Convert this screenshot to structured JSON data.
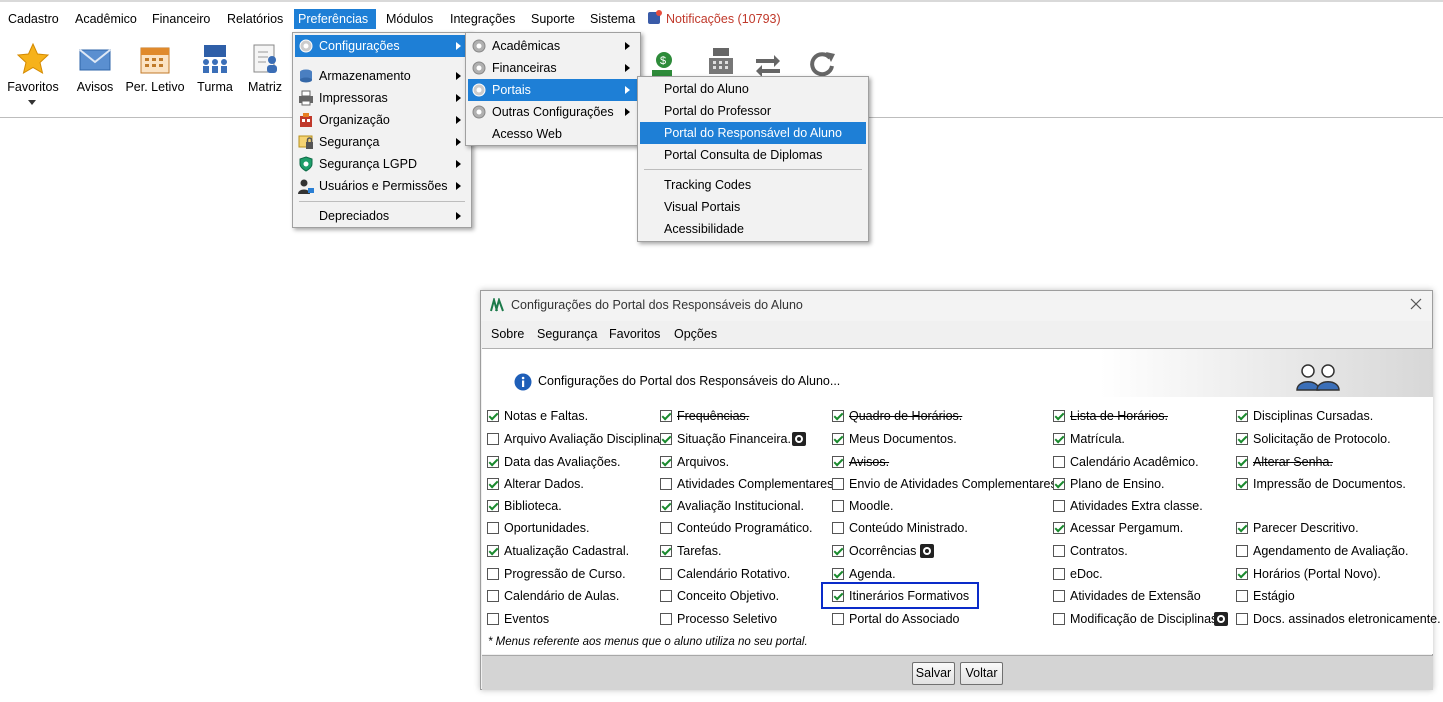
{
  "menubar": {
    "items": [
      "Cadastro",
      "Acadêmico",
      "Financeiro",
      "Relatórios",
      "Preferências",
      "Módulos",
      "Integrações",
      "Suporte",
      "Sistema"
    ],
    "notifications": "Notificações (10793)"
  },
  "toolbar": {
    "favoritos": "Favoritos",
    "avisos": "Avisos",
    "per_letivo": "Per. Letivo",
    "turma": "Turma",
    "matriz": "Matriz"
  },
  "menu_preferencias": {
    "items": [
      "Configurações",
      "Armazenamento",
      "Impressoras",
      "Organização",
      "Segurança",
      "Segurança LGPD",
      "Usuários e Permissões",
      "Depreciados"
    ]
  },
  "menu_configuracoes": {
    "items": [
      "Acadêmicas",
      "Financeiras",
      "Portais",
      "Outras Configurações",
      "Acesso Web"
    ]
  },
  "menu_portais": {
    "items": [
      "Portal do Aluno",
      "Portal do Professor",
      "Portal do Responsável do Aluno",
      "Portal Consulta de Diplomas",
      "Tracking Codes",
      "Visual Portais",
      "Acessibilidade"
    ]
  },
  "dialog": {
    "title": "Configurações do Portal dos Responsáveis do Aluno",
    "menu": [
      "Sobre",
      "Segurança",
      "Favoritos",
      "Opções"
    ],
    "header": "Configurações do Portal dos Responsáveis do Aluno...",
    "footnote": "* Menus referente aos menus que o aluno utiliza no seu portal.",
    "save": "Salvar",
    "back": "Voltar",
    "columns": [
      [
        {
          "label": "Notas e Faltas.",
          "checked": true
        },
        {
          "label": "Arquivo Avaliação Disciplina.",
          "checked": false
        },
        {
          "label": "Data das Avaliações.",
          "checked": true
        },
        {
          "label": "Alterar Dados.",
          "checked": true
        },
        {
          "label": "Biblioteca.",
          "checked": true
        },
        {
          "label": "Oportunidades.",
          "checked": false
        },
        {
          "label": "Atualização Cadastral.",
          "checked": true
        },
        {
          "label": "Progressão de Curso.",
          "checked": false
        },
        {
          "label": "Calendário de Aulas.",
          "checked": false
        },
        {
          "label": "Eventos",
          "checked": false
        }
      ],
      [
        {
          "label": "Frequências.",
          "checked": true,
          "strike": true
        },
        {
          "label": "Situação Financeira.",
          "checked": true,
          "gear": true
        },
        {
          "label": "Arquivos.",
          "checked": true
        },
        {
          "label": "Atividades Complementares.",
          "checked": false
        },
        {
          "label": "Avaliação Institucional.",
          "checked": true
        },
        {
          "label": "Conteúdo Programático.",
          "checked": false
        },
        {
          "label": "Tarefas.",
          "checked": true
        },
        {
          "label": "Calendário Rotativo.",
          "checked": false
        },
        {
          "label": "Conceito Objetivo.",
          "checked": false
        },
        {
          "label": "Processo Seletivo",
          "checked": false
        }
      ],
      [
        {
          "label": "Quadro de Horários.",
          "checked": true,
          "strike": true
        },
        {
          "label": "Meus Documentos.",
          "checked": true
        },
        {
          "label": "Avisos.",
          "checked": true,
          "strike": true
        },
        {
          "label": "Envio de Atividades Complementares.",
          "checked": false
        },
        {
          "label": "Moodle.",
          "checked": false
        },
        {
          "label": "Conteúdo Ministrado.",
          "checked": false
        },
        {
          "label": "Ocorrências",
          "checked": true,
          "gear": true
        },
        {
          "label": "Agenda.",
          "checked": true
        },
        {
          "label": "Itinerários Formativos",
          "checked": true
        },
        {
          "label": "Portal do Associado",
          "checked": false
        }
      ],
      [
        {
          "label": "Lista de Horários.",
          "checked": true,
          "strike": true
        },
        {
          "label": "Matrícula.",
          "checked": true
        },
        {
          "label": "Calendário Acadêmico.",
          "checked": false
        },
        {
          "label": "Plano de Ensino.",
          "checked": true
        },
        {
          "label": "Atividades Extra classe.",
          "checked": false
        },
        {
          "label": "Acessar Pergamum.",
          "checked": true
        },
        {
          "label": "Contratos.",
          "checked": false
        },
        {
          "label": "eDoc.",
          "checked": false
        },
        {
          "label": "Atividades de Extensão",
          "checked": false
        },
        {
          "label": "Modificação de Disciplinas",
          "checked": false,
          "gear": true
        }
      ],
      [
        {
          "label": "Disciplinas Cursadas.",
          "checked": true
        },
        {
          "label": "Solicitação de Protocolo.",
          "checked": true
        },
        {
          "label": "Alterar Senha.",
          "checked": true,
          "strike": true
        },
        {
          "label": "Impressão de Documentos.",
          "checked": true
        },
        {
          "label": "",
          "hidden": true
        },
        {
          "label": "Parecer Descritivo.",
          "checked": true
        },
        {
          "label": "Agendamento de Avaliação.",
          "checked": false
        },
        {
          "label": "Horários (Portal Novo).",
          "checked": true
        },
        {
          "label": "Estágio",
          "checked": false
        },
        {
          "label": "Docs. assinados eletronicamente.",
          "checked": false
        }
      ]
    ]
  }
}
